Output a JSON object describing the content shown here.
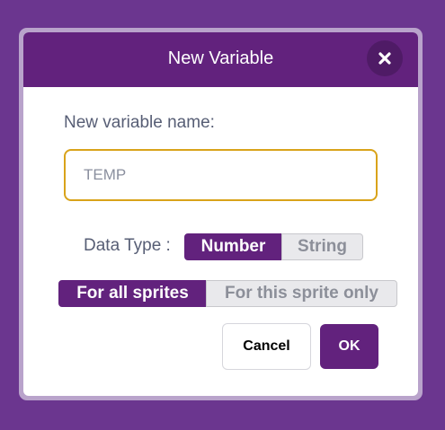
{
  "dialog": {
    "title": "New Variable",
    "close_icon": "close-icon"
  },
  "form": {
    "name_label": "New variable name:",
    "name_value": "TEMP",
    "data_type_label": "Data Type :",
    "data_types": [
      {
        "label": "Number",
        "selected": true
      },
      {
        "label": "String",
        "selected": false
      }
    ],
    "scopes": [
      {
        "label": "For all sprites",
        "selected": true
      },
      {
        "label": "For this sprite only",
        "selected": false
      }
    ]
  },
  "buttons": {
    "cancel": "Cancel",
    "ok": "OK"
  },
  "colors": {
    "backdrop": "#6b368f",
    "header": "#62227d",
    "input_border": "#d9a31a",
    "text": "#575e75"
  }
}
